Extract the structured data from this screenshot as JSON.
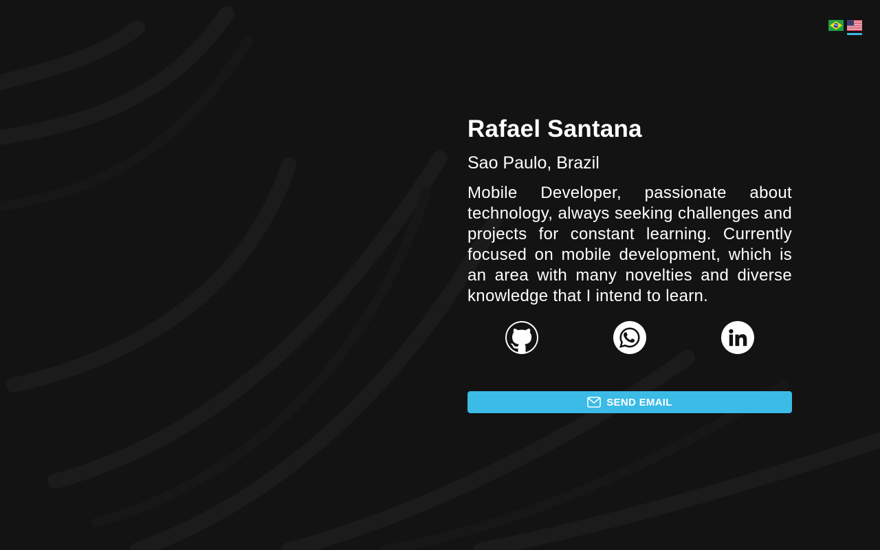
{
  "profile": {
    "name": "Rafael Santana",
    "location": "Sao Paulo, Brazil",
    "bio": "Mobile Developer, passionate about technology, always seeking challenges and projects for constant learning. Currently focused on mobile development, which is an area with many novelties and diverse knowledge that I intend to learn."
  },
  "languages": [
    {
      "code": "pt-BR",
      "icon": "brazil-flag-icon",
      "selected": false
    },
    {
      "code": "en-US",
      "icon": "usa-flag-icon",
      "selected": true
    }
  ],
  "socials": [
    {
      "icon": "github-icon"
    },
    {
      "icon": "whatsapp-icon"
    },
    {
      "icon": "linkedin-icon"
    }
  ],
  "actions": {
    "send_email_label": "SEND EMAIL",
    "send_email_icon": "mail-icon"
  },
  "colors": {
    "background": "#131313",
    "accent": "#3bbbe6",
    "text": "#ffffff"
  }
}
